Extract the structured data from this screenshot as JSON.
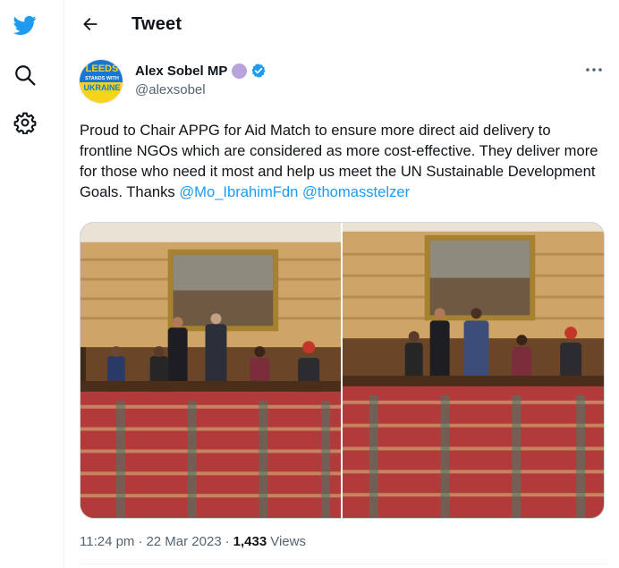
{
  "colors": {
    "brand": "#1d9bf0",
    "text": "#0f1419",
    "muted": "#536471",
    "label_badge": "#b9a3dd"
  },
  "nav": {
    "icons": [
      "twitter-bird-icon",
      "search-icon",
      "gear-icon"
    ]
  },
  "header": {
    "title": "Tweet"
  },
  "author": {
    "display_name": "Alex Sobel MP",
    "handle": "@alexsobel",
    "verified": true,
    "avatar_text": {
      "line1": "LEEDS",
      "line2": "STANDS WITH",
      "line3": "UKRAINE"
    }
  },
  "tweet": {
    "text": "Proud to Chair APPG for Aid Match to ensure more direct aid delivery to frontline NGOs which are considered as more cost-effective. They deliver more for those who need it most and help us meet the UN Sustainable Development Goals. Thanks",
    "mention1": "@Mo_IbrahimFdn",
    "mention2": "@thomasstelzer"
  },
  "meta": {
    "time": "11:24 pm",
    "separator": "·",
    "date": "22 Mar 2023",
    "views_count": "1,433",
    "views_label": "Views"
  }
}
